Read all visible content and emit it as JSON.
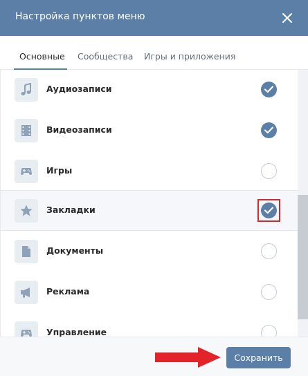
{
  "dialog": {
    "title": "Настройка пунктов меню",
    "close_icon": "close-icon"
  },
  "tabs": [
    {
      "label": "Основные",
      "active": true
    },
    {
      "label": "Сообщества",
      "active": false
    },
    {
      "label": "Игры и приложения",
      "active": false
    }
  ],
  "items": [
    {
      "label": "Аудиозаписи",
      "icon": "music-note-icon",
      "checked": true
    },
    {
      "label": "Видеозаписи",
      "icon": "film-icon",
      "checked": true
    },
    {
      "label": "Игры",
      "icon": "gamepad-icon",
      "checked": false
    },
    {
      "label": "Закладки",
      "icon": "star-icon",
      "checked": true
    },
    {
      "label": "Документы",
      "icon": "document-icon",
      "checked": false
    },
    {
      "label": "Реклама",
      "icon": "megaphone-icon",
      "checked": false
    },
    {
      "label": "Управление",
      "icon": "gamepad-icon",
      "checked": false
    }
  ],
  "footer": {
    "save_label": "Сохранить"
  },
  "colors": {
    "header": "#5b7fa6",
    "accent": "#5181b8",
    "annotation": "#d9262a"
  }
}
